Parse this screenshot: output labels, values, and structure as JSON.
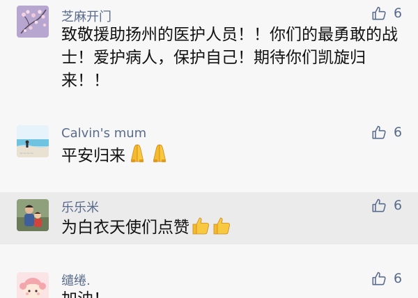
{
  "comments": [
    {
      "name": "芝麻开门",
      "likes": "6",
      "text": "致敬援助扬州的医护人员！！你们的最勇敢的战士！爱护病人，保护自己！期待你们凯旋归来！！",
      "avatar_icon": "cherry-blossom-avatar"
    },
    {
      "name": "Calvin's mum",
      "likes": "6",
      "text": "平安归来",
      "emojis": [
        "praying-hands-emoji",
        "praying-hands-emoji"
      ],
      "avatar_icon": "beach-avatar"
    },
    {
      "name": "乐乐米",
      "likes": "6",
      "text": "为白衣天使们点赞",
      "emojis": [
        "thumbs-up-emoji",
        "thumbs-up-emoji"
      ],
      "avatar_icon": "family-photo-avatar"
    },
    {
      "name": "缱绻.",
      "likes": "6",
      "text": "加油！",
      "avatar_icon": "cartoon-girl-avatar"
    }
  ],
  "colors": {
    "name": "#596b8c",
    "text": "#111111",
    "background": "#f7f7f7",
    "highlight": "#ebebeb"
  }
}
